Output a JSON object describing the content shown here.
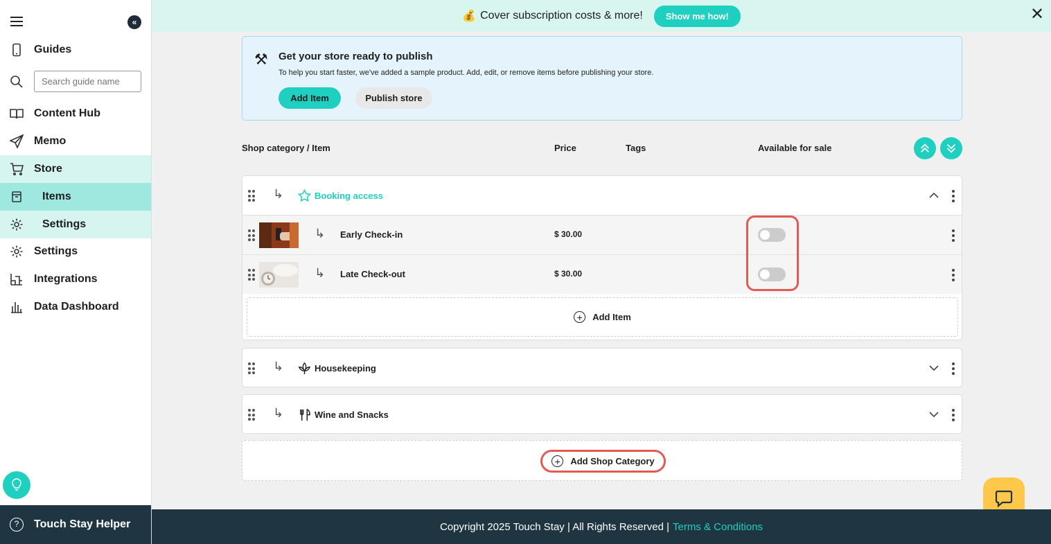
{
  "sidebar": {
    "items": [
      {
        "label": "Guides",
        "icon": "phone-icon"
      },
      {
        "label": "Content Hub",
        "icon": "book-icon"
      },
      {
        "label": "Memo",
        "icon": "paper-plane-icon"
      },
      {
        "label": "Store",
        "icon": "cart-icon"
      },
      {
        "label": "Items",
        "icon": "archive-icon"
      },
      {
        "label": "Settings",
        "icon": "gear-icon"
      },
      {
        "label": "Settings",
        "icon": "gear-icon"
      },
      {
        "label": "Integrations",
        "icon": "grid-icon"
      },
      {
        "label": "Data Dashboard",
        "icon": "bar-chart-icon"
      }
    ],
    "search_placeholder": "Search guide name",
    "helper_label": "Touch Stay Helper"
  },
  "banner": {
    "text": "Cover subscription costs & more!",
    "button": "Show me how!"
  },
  "info": {
    "title": "Get your store ready to publish",
    "description": "To help you start faster, we've added a sample product. Add, edit, or remove items before publishing your store.",
    "add_item": "Add Item",
    "publish": "Publish store"
  },
  "table_header": {
    "category": "Shop category / Item",
    "price": "Price",
    "tags": "Tags",
    "available": "Available for sale"
  },
  "categories": [
    {
      "name": "Booking access",
      "icon": "star-icon",
      "expanded": true,
      "items": [
        {
          "name": "Early Check-in",
          "price": "$ 30.00",
          "available": false
        },
        {
          "name": "Late Check-out",
          "price": "$ 30.00",
          "available": false
        }
      ],
      "add_item_label": "Add Item"
    },
    {
      "name": "Housekeeping",
      "icon": "lotus-icon",
      "expanded": false
    },
    {
      "name": "Wine and Snacks",
      "icon": "utensils-icon",
      "expanded": false
    }
  ],
  "add_category_label": "Add Shop Category",
  "footer": {
    "copyright": "Copyright 2025 Touch Stay | All Rights Reserved |",
    "terms": "Terms & Conditions"
  },
  "colors": {
    "accent": "#1fcfc0",
    "highlight": "#e35a52",
    "footer": "#1f3642"
  }
}
